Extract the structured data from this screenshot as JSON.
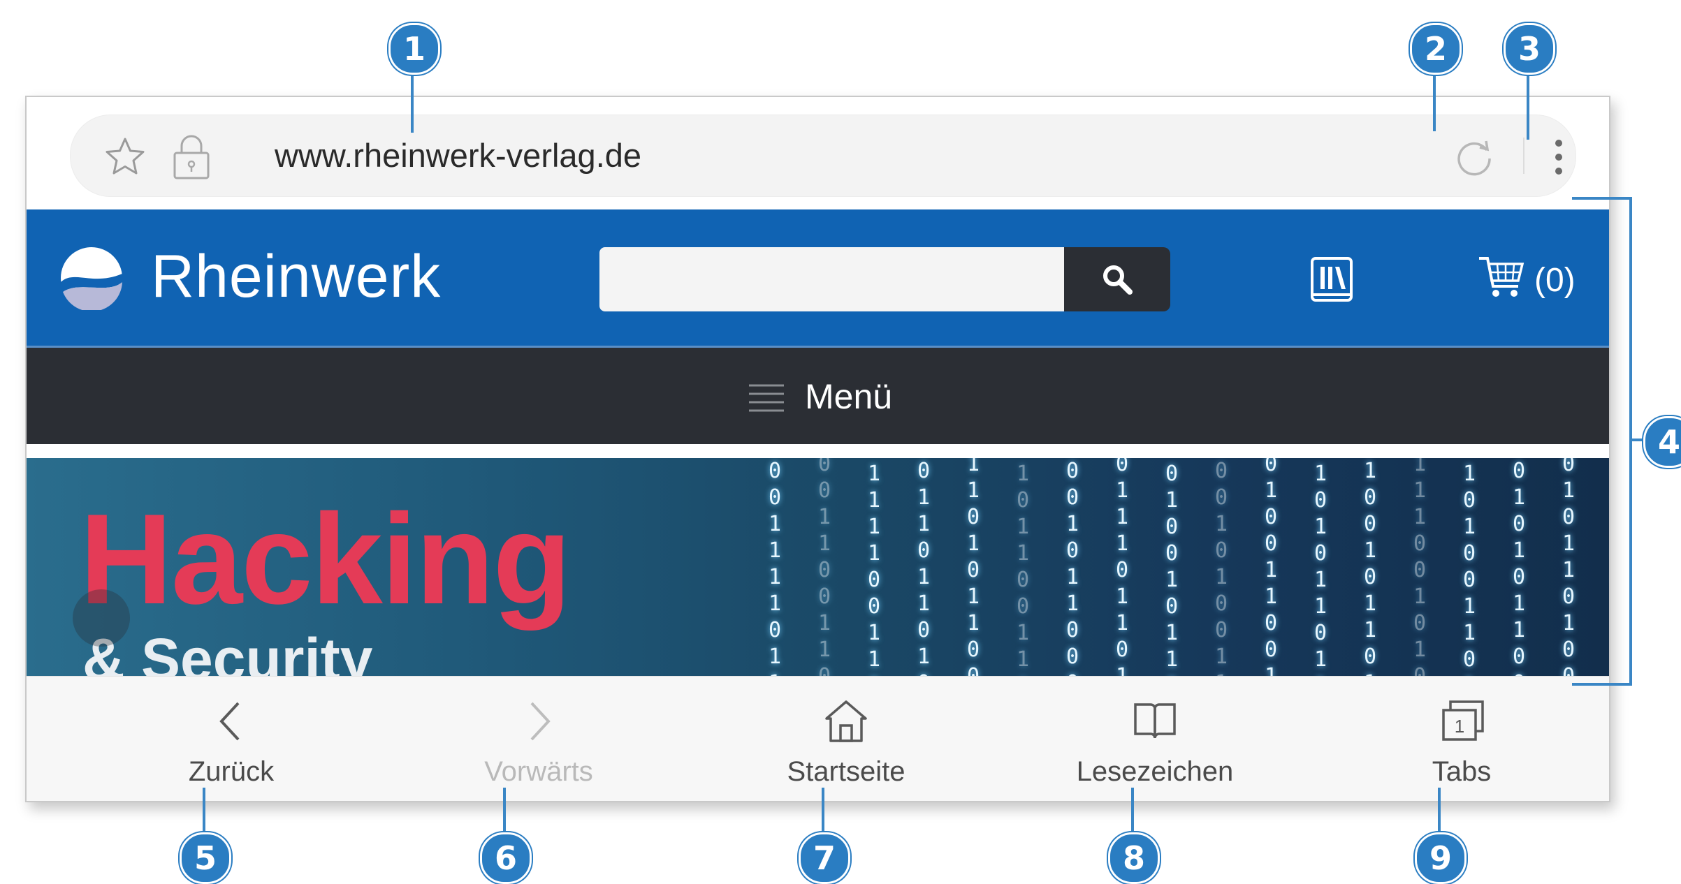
{
  "browser": {
    "url": "www.rheinwerk-verlag.de",
    "icons": [
      "star-icon",
      "lock-icon",
      "reload-icon",
      "more-vert-icon"
    ]
  },
  "site": {
    "brand": "Rheinwerk",
    "search_placeholder": "",
    "cart_count": "(0)",
    "menu_label": "Menü",
    "brand_color": "#1063b3",
    "dark_color": "#2b2e34"
  },
  "banner": {
    "title": "Hacking",
    "subtitle": "& Security",
    "title_color": "#e43b57",
    "binary_columns": [
      "0\n0\n1\n1\n1\n1\n0\n1\n1",
      "0\n0\n1\n1\n0\n0\n1\n1\n0",
      "1\n1\n1\n1\n0\n0\n1\n1\n0",
      "0\n1\n1\n0\n1\n1\n0\n1\n0",
      "1\n1\n0\n1\n0\n1\n1\n0\n0",
      "1\n0\n1\n1\n0\n0\n1\n1\n0",
      "0\n0\n1\n0\n1\n1\n0\n0\n0",
      "0\n1\n1\n1\n0\n1\n1\n0\n1",
      "0\n1\n0\n0\n1\n0\n1\n1\n0",
      "0\n0\n1\n0\n1\n0\n0\n1\n1",
      "0\n1\n0\n0\n1\n1\n0\n0\n1",
      "1\n0\n1\n0\n1\n1\n0\n1\n1",
      "1\n0\n0\n1\n0\n1\n1\n0\n1",
      "1\n1\n1\n0\n0\n1\n0\n1\n0",
      "1\n0\n1\n0\n0\n1\n1\n0\n1",
      "0\n1\n0\n1\n0\n1\n1\n0\n0",
      "0\n1\n0\n1\n1\n0\n1\n0\n0",
      "0\n0\n1\n0\n0\n1\n1\n1\n0"
    ]
  },
  "bottom_nav": {
    "back": "Zurück",
    "forward": "Vorwärts",
    "home": "Startseite",
    "bookmarks": "Lesezeichen",
    "tabs": "Tabs",
    "tab_count": "1"
  },
  "callouts": {
    "c1": "1",
    "c2": "2",
    "c3": "3",
    "c4": "4",
    "c5": "5",
    "c6": "6",
    "c7": "7",
    "c8": "8",
    "c9": "9",
    "color": "#2a7dc2"
  }
}
